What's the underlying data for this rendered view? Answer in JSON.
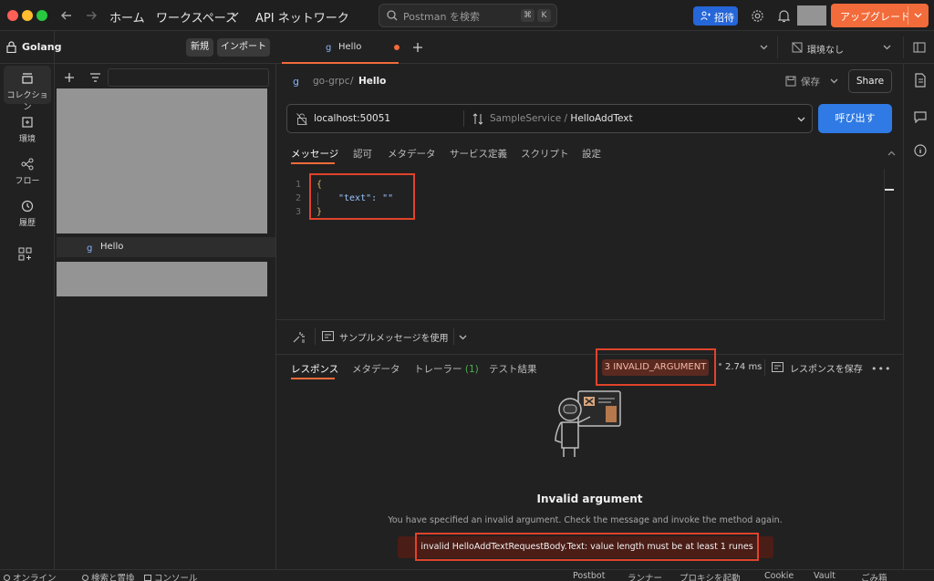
{
  "titlebar": {
    "nav": [
      "ホーム",
      "ワークスペース",
      "API ネットワーク"
    ],
    "search_placeholder": "Postman を検索",
    "kbd": [
      "⌘",
      "K"
    ],
    "invite": "招待",
    "upgrade": "アップグレード",
    "traffic_colors": [
      "#fe5f57",
      "#febc2e",
      "#28c840"
    ]
  },
  "rail": {
    "items": [
      {
        "label": "コレクション",
        "icon": "collection-icon"
      },
      {
        "label": "環境",
        "icon": "environment-icon"
      },
      {
        "label": "フロー",
        "icon": "flow-icon"
      },
      {
        "label": "履歴",
        "icon": "history-icon"
      }
    ]
  },
  "sidebar": {
    "workspace": "Golang",
    "new_label": "新規",
    "import_label": "インポート",
    "tree_item": "Hello"
  },
  "tabbar": {
    "tab_label": "Hello",
    "environment": "環境なし"
  },
  "request": {
    "breadcrumb_parent": "go-grpc",
    "breadcrumb_sep": "/",
    "breadcrumb_current": "Hello",
    "save_label": "保存",
    "share_label": "Share",
    "url": "localhost:50051",
    "method_service": "SampleService",
    "method_sep": "/",
    "method_name": "HelloAddText",
    "invoke_label": "呼び出す",
    "tabs": [
      "メッセージ",
      "認可",
      "メタデータ",
      "サービス定義",
      "スクリプト",
      "設定"
    ],
    "code_lines": [
      "{",
      "\"text\": \"\"",
      "}"
    ],
    "line_numbers": [
      "1",
      "2",
      "3"
    ],
    "sample_message_label": "サンプルメッセージを使用"
  },
  "response": {
    "tabs": [
      "レスポンス",
      "メタデータ",
      "トレーラー",
      "テスト結果"
    ],
    "trailer_count": "(1)",
    "status": "3 INVALID_ARGUMENT",
    "time": "2.74 ms",
    "save_response": "レスポンスを保存",
    "error_title": "Invalid argument",
    "error_desc": "You have specified an invalid argument. Check the message and invoke the method again.",
    "error_message": "invalid HelloAddTextRequestBody.Text: value length must be at least 1 runes"
  },
  "statusbar": {
    "left": [
      "オンライン",
      "検索と置換",
      "コンソール"
    ],
    "right": [
      "Postbot",
      "ランナー",
      "プロキシを起動",
      "Cookie",
      "Vault",
      "ごみ箱"
    ]
  },
  "colors": {
    "accent_orange": "#f26b3a",
    "primary_blue": "#2f7ae5",
    "error_red": "#e0432b",
    "status_bg": "#5a2a20"
  }
}
